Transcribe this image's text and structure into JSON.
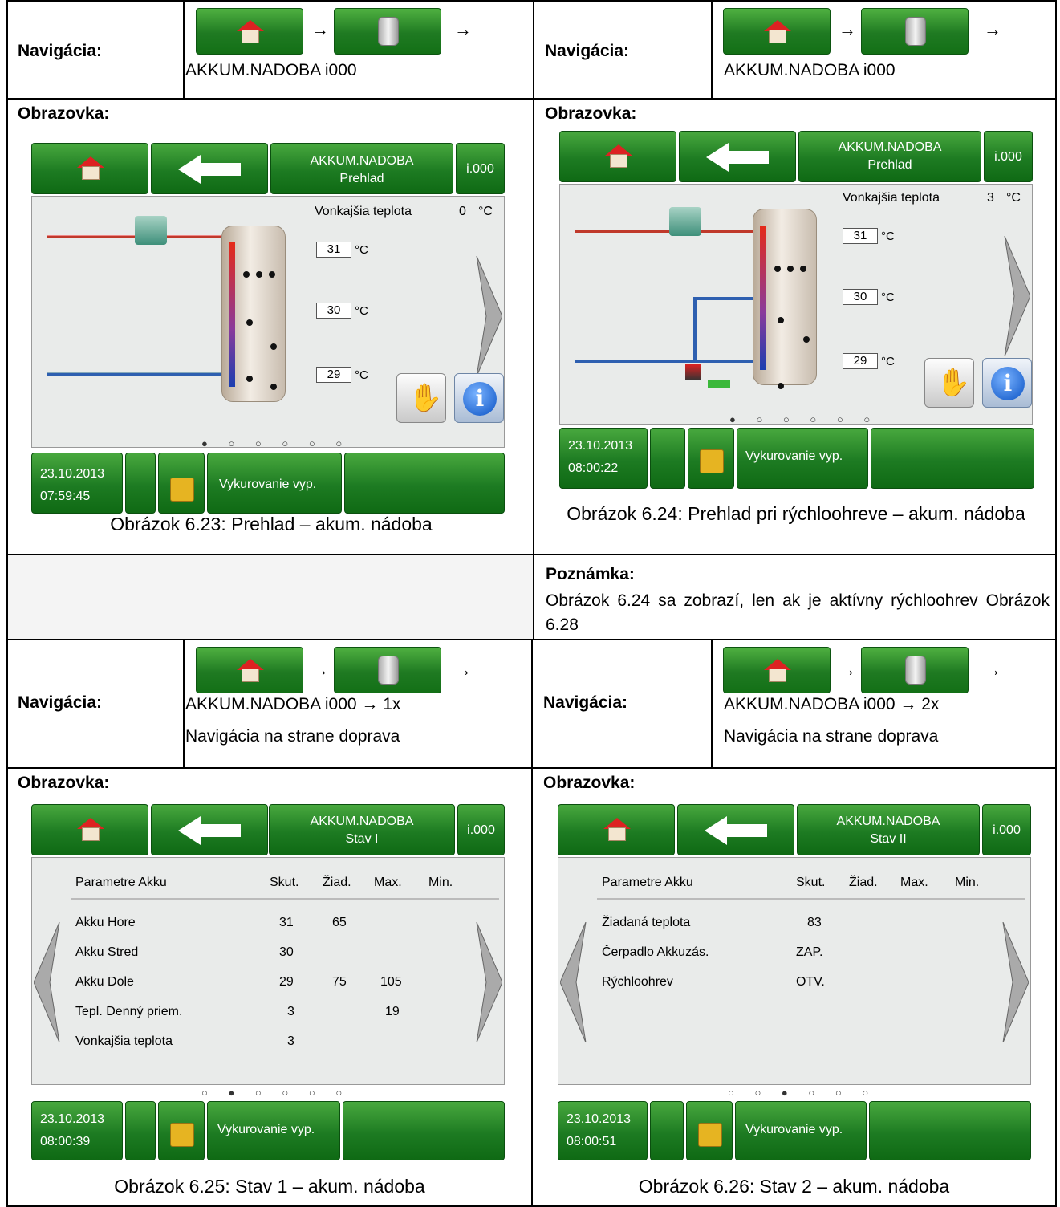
{
  "nav_label": "Navigácia:",
  "screen_label": "Obrazovka:",
  "note_label": "Poznámka:",
  "note_text": "Obrázok 6.24 sa zobrazí, len ak je aktívny rýchloohrev Obrázok 6.28",
  "arrow": "→",
  "nav": {
    "n1": "AKKUM.NADOBA i000",
    "n2": "AKKUM.NADOBA i000",
    "n3": "AKKUM.NADOBA i000 → 1x",
    "n3b": "Navigácia na strane doprava",
    "n4": "AKKUM.NADOBA i000 → 2x",
    "n4b": "Navigácia na strane doprava"
  },
  "captions": {
    "c1": "Obrázok 6.23: Prehlad – akum. nádoba",
    "c2": "Obrázok 6.24: Prehlad pri rýchloohreve – akum. nádoba",
    "c3": "Obrázok 6.25: Stav 1 – akum. nádoba",
    "c4": "Obrázok 6.26: Stav 2 – akum. nádoba"
  },
  "screens": {
    "s1": {
      "title": "AKKUM.NADOBA",
      "subtitle": "Prehlad",
      "index": "i.000",
      "outside_label": "Vonkajšia teplota",
      "outside_value": "0",
      "unit": "°C",
      "t_top": "31",
      "t_mid": "30",
      "t_bot": "29",
      "date": "23.10.2013",
      "time": "07:59:45",
      "status": "Vykurovanie vyp.",
      "dots": "● ○ ○ ○ ○ ○"
    },
    "s2": {
      "title": "AKKUM.NADOBA",
      "subtitle": "Prehlad",
      "index": "i.000",
      "outside_label": "Vonkajšia teplota",
      "outside_value": "3",
      "unit": "°C",
      "t_top": "31",
      "t_mid": "30",
      "t_bot": "29",
      "date": "23.10.2013",
      "time": "08:00:22",
      "status": "Vykurovanie vyp.",
      "dots": "● ○ ○ ○ ○ ○"
    },
    "s3": {
      "title": "AKKUM.NADOBA",
      "subtitle": "Stav I",
      "index": "i.000",
      "date": "23.10.2013",
      "time": "08:00:39",
      "status": "Vykurovanie vyp.",
      "dots": "○ ● ○ ○ ○ ○",
      "headers": [
        "Parametre Akku",
        "Skut.",
        "Žiad.",
        "Max.",
        "Min."
      ],
      "rows": [
        [
          "Akku Hore",
          "31",
          "65",
          "",
          ""
        ],
        [
          "Akku Stred",
          "30",
          "",
          "",
          ""
        ],
        [
          "Akku Dole",
          "29",
          "75",
          "105",
          ""
        ],
        [
          "Tepl. Denný priem.",
          "3",
          "",
          "19",
          ""
        ],
        [
          "Vonkajšia teplota",
          "3",
          "",
          "",
          ""
        ]
      ]
    },
    "s4": {
      "title": "AKKUM.NADOBA",
      "subtitle": "Stav II",
      "index": "i.000",
      "date": "23.10.2013",
      "time": "08:00:51",
      "status": "Vykurovanie vyp.",
      "dots": "○ ○ ● ○ ○ ○",
      "headers": [
        "Parametre Akku",
        "Skut.",
        "Žiad.",
        "Max.",
        "Min."
      ],
      "rows": [
        [
          "Žiadaná teplota",
          "83",
          "",
          "",
          ""
        ],
        [
          "Čerpadlo Akkuzás.",
          "ZAP.",
          "",
          "",
          ""
        ],
        [
          "Rýchloohrev",
          "OTV.",
          "",
          "",
          ""
        ]
      ]
    }
  }
}
